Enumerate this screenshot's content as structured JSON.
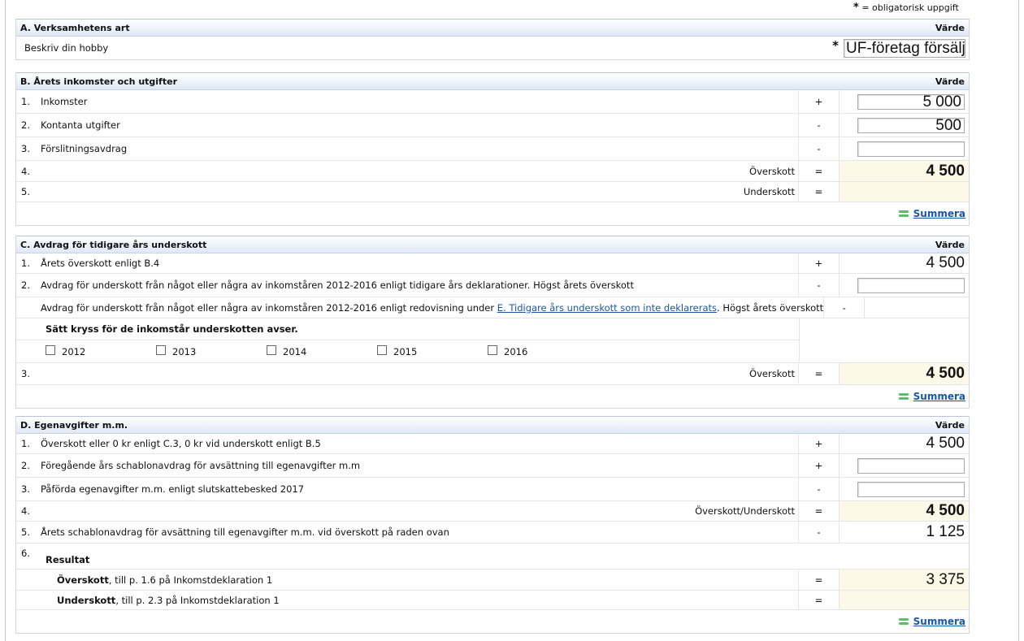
{
  "legend": {
    "star": "*",
    "text": "= obligatorisk uppgift"
  },
  "summera_label": "Summera",
  "sectionA": {
    "title": "A. Verksamhetens art",
    "value_header": "Värde",
    "row": {
      "label": "Beskriv din hobby",
      "required": "*",
      "value": "UF-företag försäljn"
    }
  },
  "sectionB": {
    "title": "B. Årets inkomster och utgifter",
    "value_header": "Värde",
    "rows": [
      {
        "num": "1.",
        "label": "Inkomster",
        "op": "+",
        "value": "5 000"
      },
      {
        "num": "2.",
        "label": "Kontanta utgifter",
        "op": "-",
        "value": "500"
      },
      {
        "num": "3.",
        "label": "Förslitningsavdrag",
        "op": "-",
        "value": ""
      },
      {
        "num": "4.",
        "label": "Överskott",
        "op": "=",
        "value": "4 500"
      },
      {
        "num": "5.",
        "label": "Underskott",
        "op": "=",
        "value": ""
      }
    ]
  },
  "sectionC": {
    "title": "C. Avdrag för tidigare års underskott",
    "value_header": "Värde",
    "row1": {
      "num": "1.",
      "label": "Årets överskott enligt B.4",
      "op": "+",
      "value": "4 500"
    },
    "row2": {
      "num": "2.",
      "label": "Avdrag för underskott från något eller några av inkomståren 2012-2016 enligt tidigare års deklarationer. Högst årets överskott",
      "op": "-",
      "value": ""
    },
    "row2b": {
      "prefix": "Avdrag för underskott från något eller några av inkomståren 2012-2016 enligt redovisning under ",
      "link": "E. Tidigare års underskott som inte deklarerats",
      "suffix": ". Högst årets överskott",
      "op": "-"
    },
    "years_heading": "Sätt kryss för de inkomstår underskotten avser.",
    "years": [
      "2012",
      "2013",
      "2014",
      "2015",
      "2016"
    ],
    "row3": {
      "num": "3.",
      "label": "Överskott",
      "op": "=",
      "value": "4 500"
    }
  },
  "sectionD": {
    "title": "D. Egenavgifter m.m.",
    "value_header": "Värde",
    "row1": {
      "num": "1.",
      "label": "Överskott eller 0 kr enligt C.3, 0 kr vid underskott enligt B.5",
      "op": "+",
      "value": "4 500"
    },
    "row2": {
      "num": "2.",
      "label": "Föregående års schablonavdrag för avsättning till egenavgifter m.m",
      "op": "+",
      "value": ""
    },
    "row3": {
      "num": "3.",
      "label": "Påförda egenavgifter m.m. enligt slutskattebesked 2017",
      "op": "-",
      "value": ""
    },
    "row4": {
      "num": "4.",
      "label": "Överskott/Underskott",
      "op": "=",
      "value": "4 500"
    },
    "row5": {
      "num": "5.",
      "label": "Årets schablonavdrag för avsättning till egenavgifter m.m. vid överskott på raden ovan",
      "op": "-",
      "value": "1 125"
    },
    "row6": {
      "num": "6.",
      "label": "Resultat"
    },
    "overskott": {
      "bold": "Överskott",
      "rest": ", till p. 1.6 på Inkomstdeklaration 1",
      "op": "=",
      "value": "3 375"
    },
    "underskott": {
      "bold": "Underskott",
      "rest": ", till p. 2.3 på Inkomstdeklaration 1",
      "op": "=",
      "value": ""
    }
  }
}
